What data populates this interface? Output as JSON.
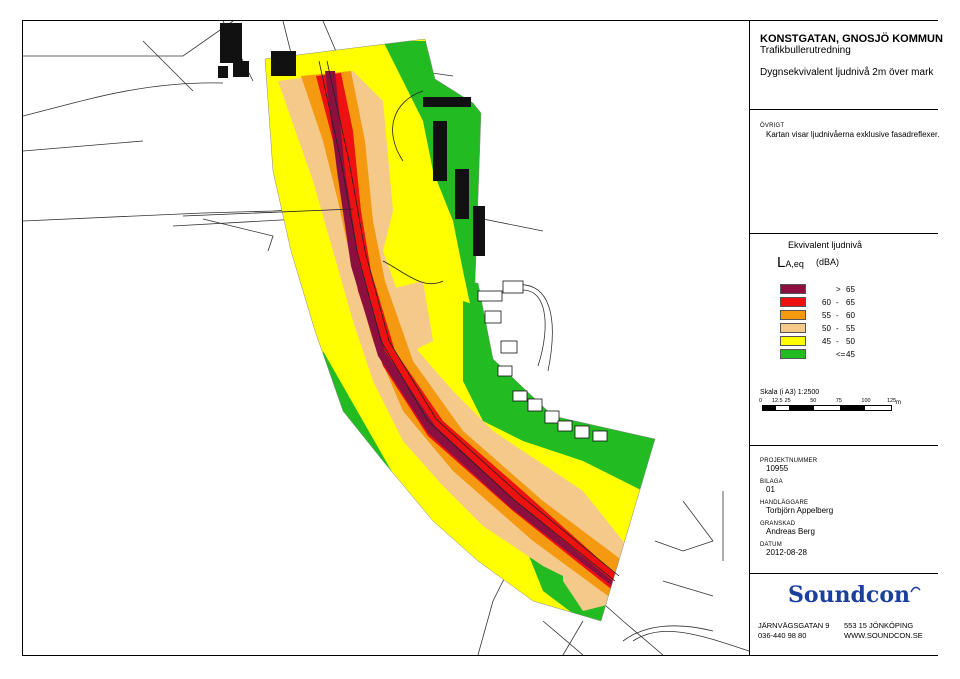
{
  "title_block": {
    "project": "KONSTGATAN, GNOSJÖ KOMMUN",
    "subtitle": "Trafikbullerutredning",
    "description": "Dygnsekvivalent ljudnivå 2m över mark",
    "other_label": "ÖVRIGT",
    "other_text": "Kartan visar ljudnivåerna exklusive fasadreflexer."
  },
  "legend": {
    "heading": "Ekvivalent ljudnivå",
    "symbol_main": "L",
    "symbol_sub": "A,eq",
    "unit": "(dBA)",
    "classes": [
      {
        "low": "",
        "sep": ">",
        "high": "65",
        "color": "#8b1040"
      },
      {
        "low": "60",
        "sep": "-",
        "high": "65",
        "color": "#ee1111"
      },
      {
        "low": "55",
        "sep": "-",
        "high": "60",
        "color": "#f59a10"
      },
      {
        "low": "50",
        "sep": "-",
        "high": "55",
        "color": "#f5c98a"
      },
      {
        "low": "45",
        "sep": "-",
        "high": "50",
        "color": "#ffff00"
      },
      {
        "low": "",
        "sep": "<=",
        "high": "45",
        "color": "#22bb22"
      }
    ]
  },
  "scale": {
    "label": "Skala (i A3) 1:2500",
    "ticks": [
      "0",
      "12.5",
      "25",
      "50",
      "75",
      "100",
      "125"
    ],
    "unit": "m"
  },
  "info": {
    "project_number_label": "PROJEKTNUMMER",
    "project_number": "10955",
    "appendix_label": "BILAGA",
    "appendix": "01",
    "handler_label": "HANDLÄGGARE",
    "handler": "Torbjörn Appelberg",
    "reviewer_label": "GRANSKAD",
    "reviewer": "Andreas Berg",
    "date_label": "DATUM",
    "date": "2012-08-28"
  },
  "company": {
    "logo_text": "Soundcon",
    "street": "JÄRNVÄGSGATAN 9",
    "postal": "553 15 JÖNKÖPING",
    "phone": "036-440 98 80",
    "web": "WWW.SOUNDCON.SE"
  }
}
